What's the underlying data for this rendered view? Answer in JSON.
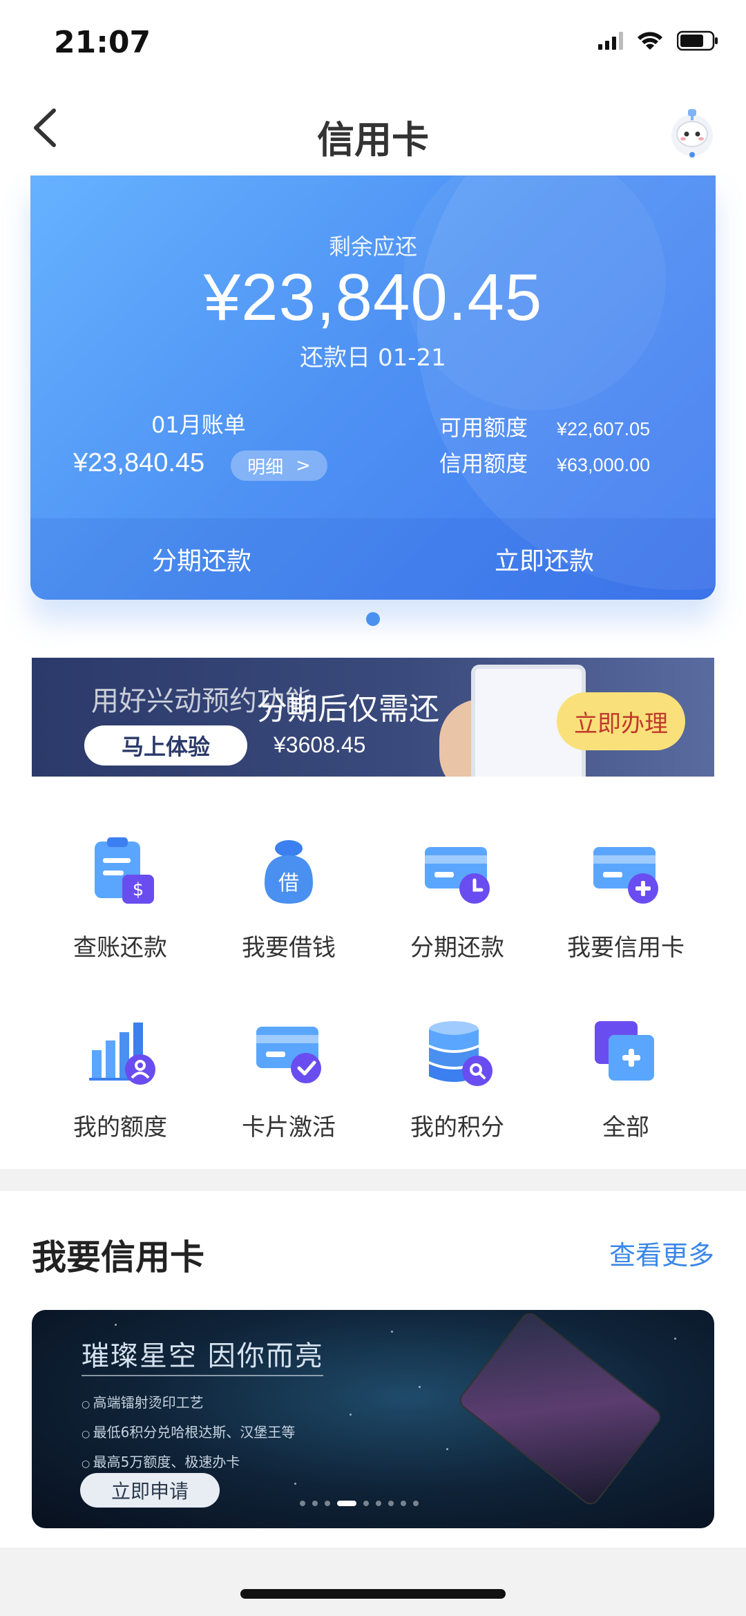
{
  "status": {
    "time": "21:07"
  },
  "nav": {
    "title": "信用卡"
  },
  "card": {
    "remain_label": "剩余应还",
    "remain_amount": "¥23,840.45",
    "due_date": "还款日  01-21",
    "bill_month": "01月账单",
    "bill_amount": "¥23,840.45",
    "detail_label": "明细",
    "detail_arrow": ">",
    "available_label": "可用额度",
    "available_value": "¥22,607.05",
    "credit_label": "信用额度",
    "credit_value": "¥63,000.00",
    "installment_button": "分期还款",
    "repay_now_button": "立即还款"
  },
  "banner": {
    "text_back": "用好兴动预约功能",
    "text_front": "分期后仅需还",
    "try_button": "马上体验",
    "amount": "¥3608.45",
    "apply_button": "立即办理"
  },
  "grid": [
    {
      "label": "查账还款",
      "icon": "bill-check-icon"
    },
    {
      "label": "我要借钱",
      "icon": "loan-bag-icon"
    },
    {
      "label": "分期还款",
      "icon": "installment-card-icon"
    },
    {
      "label": "我要信用卡",
      "icon": "add-card-icon"
    },
    {
      "label": "我的额度",
      "icon": "quota-chart-icon"
    },
    {
      "label": "卡片激活",
      "icon": "card-activate-icon"
    },
    {
      "label": "我的积分",
      "icon": "points-db-icon"
    },
    {
      "label": "全部",
      "icon": "all-plus-icon"
    }
  ],
  "loan_icon_char": "借",
  "section": {
    "title": "我要信用卡",
    "more": "查看更多"
  },
  "promo": {
    "title": "璀璨星空 因你而亮",
    "features": [
      "高端镭射烫印工艺",
      "最低6积分兑哈根达斯、汉堡王等",
      "最高5万额度、极速办卡"
    ],
    "apply_button": "立即申请"
  },
  "colors": {
    "accent": "#3a86e8",
    "card_gradient_start": "#66b2ff",
    "card_gradient_end": "#3f78ef"
  }
}
